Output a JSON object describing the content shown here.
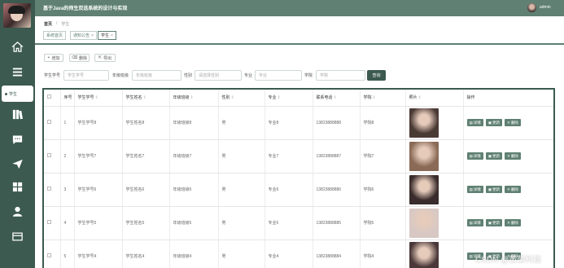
{
  "app": {
    "title": "基于Java的师生双选系统的设计与实现",
    "user_name": "admin"
  },
  "sidebar": {
    "active_label": "学生",
    "icons": [
      "home-icon",
      "list-icon",
      "user-icon",
      "book-icon",
      "message-icon",
      "send-icon",
      "grid-icon",
      "profile-icon",
      "card-icon"
    ]
  },
  "breadcrumb": [
    "首页",
    "学生"
  ],
  "tabs": [
    {
      "label": "系统首页",
      "closable": false,
      "active": false
    },
    {
      "label": "通知公告",
      "closable": true,
      "active": false
    },
    {
      "label": "学生",
      "closable": true,
      "active": true
    }
  ],
  "toolbar": {
    "add_label": "增加",
    "delete_label": "删除",
    "export_label": "导出"
  },
  "search": {
    "fields": [
      {
        "label": "学生学号",
        "placeholder": "学生学号"
      },
      {
        "label": "年级班级",
        "placeholder": "年级班级"
      },
      {
        "label": "性别",
        "placeholder": "请选择性别"
      },
      {
        "label": "专业",
        "placeholder": "专业"
      },
      {
        "label": "学院",
        "placeholder": "学院"
      }
    ],
    "button_label": "查询"
  },
  "table": {
    "headers": [
      "序号",
      "学生学号",
      "学生姓名",
      "年级班级",
      "性别",
      "专业",
      "联系电话",
      "学院",
      "照片",
      "操作"
    ],
    "actions": {
      "detail": "详情",
      "edit": "更新",
      "delete": "删除"
    },
    "rows": [
      {
        "index": "1",
        "student_no": "学生学号8",
        "name": "学生姓名8",
        "grade_class": "年级班级8",
        "gender": "男",
        "major": "专业8",
        "phone": "13823888888",
        "college": "学院8",
        "photo": "#4a3a34"
      },
      {
        "index": "2",
        "student_no": "学生学号7",
        "name": "学生姓名7",
        "grade_class": "年级班级7",
        "gender": "男",
        "major": "专业7",
        "phone": "13823888887",
        "college": "学院7",
        "photo": "#8a6a56"
      },
      {
        "index": "3",
        "student_no": "学生学号6",
        "name": "学生姓名6",
        "grade_class": "年级班级6",
        "gender": "男",
        "major": "专业6",
        "phone": "13823888886",
        "college": "学院6",
        "photo": "#3a2c2c"
      },
      {
        "index": "4",
        "student_no": "学生学号5",
        "name": "学生姓名5",
        "grade_class": "年级班级5",
        "gender": "男",
        "major": "专业5",
        "phone": "13823888885",
        "college": "学院5",
        "photo": "#d8c8c4"
      },
      {
        "index": "5",
        "student_no": "学生学号4",
        "name": "学生姓名4",
        "grade_class": "年级班级4",
        "gender": "男",
        "major": "专业4",
        "phone": "13823888884",
        "college": "学院4",
        "photo": "#4a3838"
      }
    ]
  },
  "watermark": "CSDN @黄菊科技"
}
